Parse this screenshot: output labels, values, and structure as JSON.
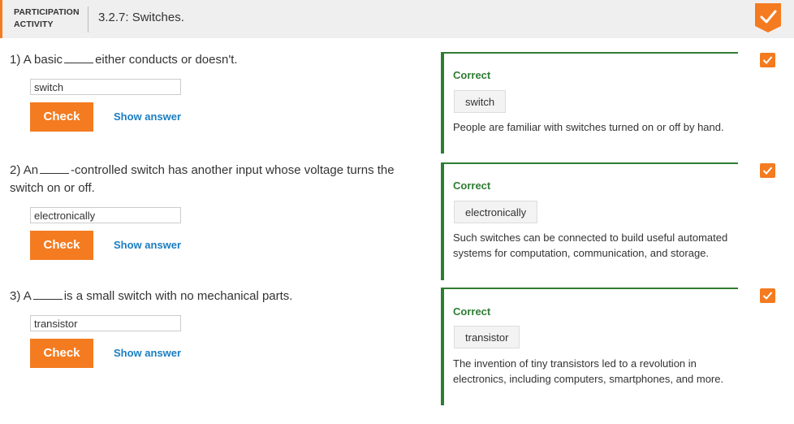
{
  "header": {
    "participation_label_line1": "PARTICIPATION",
    "participation_label_line2": "ACTIVITY",
    "title": "3.2.7: Switches.",
    "accent_color": "#f47b20"
  },
  "questions": [
    {
      "number": "1)",
      "text_before": "A basic",
      "text_after": "either conducts or doesn't.",
      "input_value": "switch",
      "check_label": "Check",
      "show_answer_label": "Show answer",
      "feedback": {
        "status": "Correct",
        "answer": "switch",
        "explanation": "People are familiar with switches turned on or off by hand."
      }
    },
    {
      "number": "2)",
      "text_before": "An",
      "text_after": "-controlled switch has another input whose voltage turns the switch on or off.",
      "input_value": "electronically",
      "check_label": "Check",
      "show_answer_label": "Show answer",
      "feedback": {
        "status": "Correct",
        "answer": "electronically",
        "explanation": "Such switches can be connected to build useful automated systems for computation, communication, and storage."
      }
    },
    {
      "number": "3)",
      "text_before": "A",
      "text_after": "is a small switch with no mechanical parts.",
      "input_value": "transistor",
      "check_label": "Check",
      "show_answer_label": "Show answer",
      "feedback": {
        "status": "Correct",
        "answer": "transistor",
        "explanation": "The invention of tiny transistors led to a revolution in electronics, including computers, smartphones, and more."
      }
    }
  ],
  "colors": {
    "correct_green": "#2e7d32",
    "link_blue": "#1a7ec2",
    "button_orange": "#f47b20"
  }
}
